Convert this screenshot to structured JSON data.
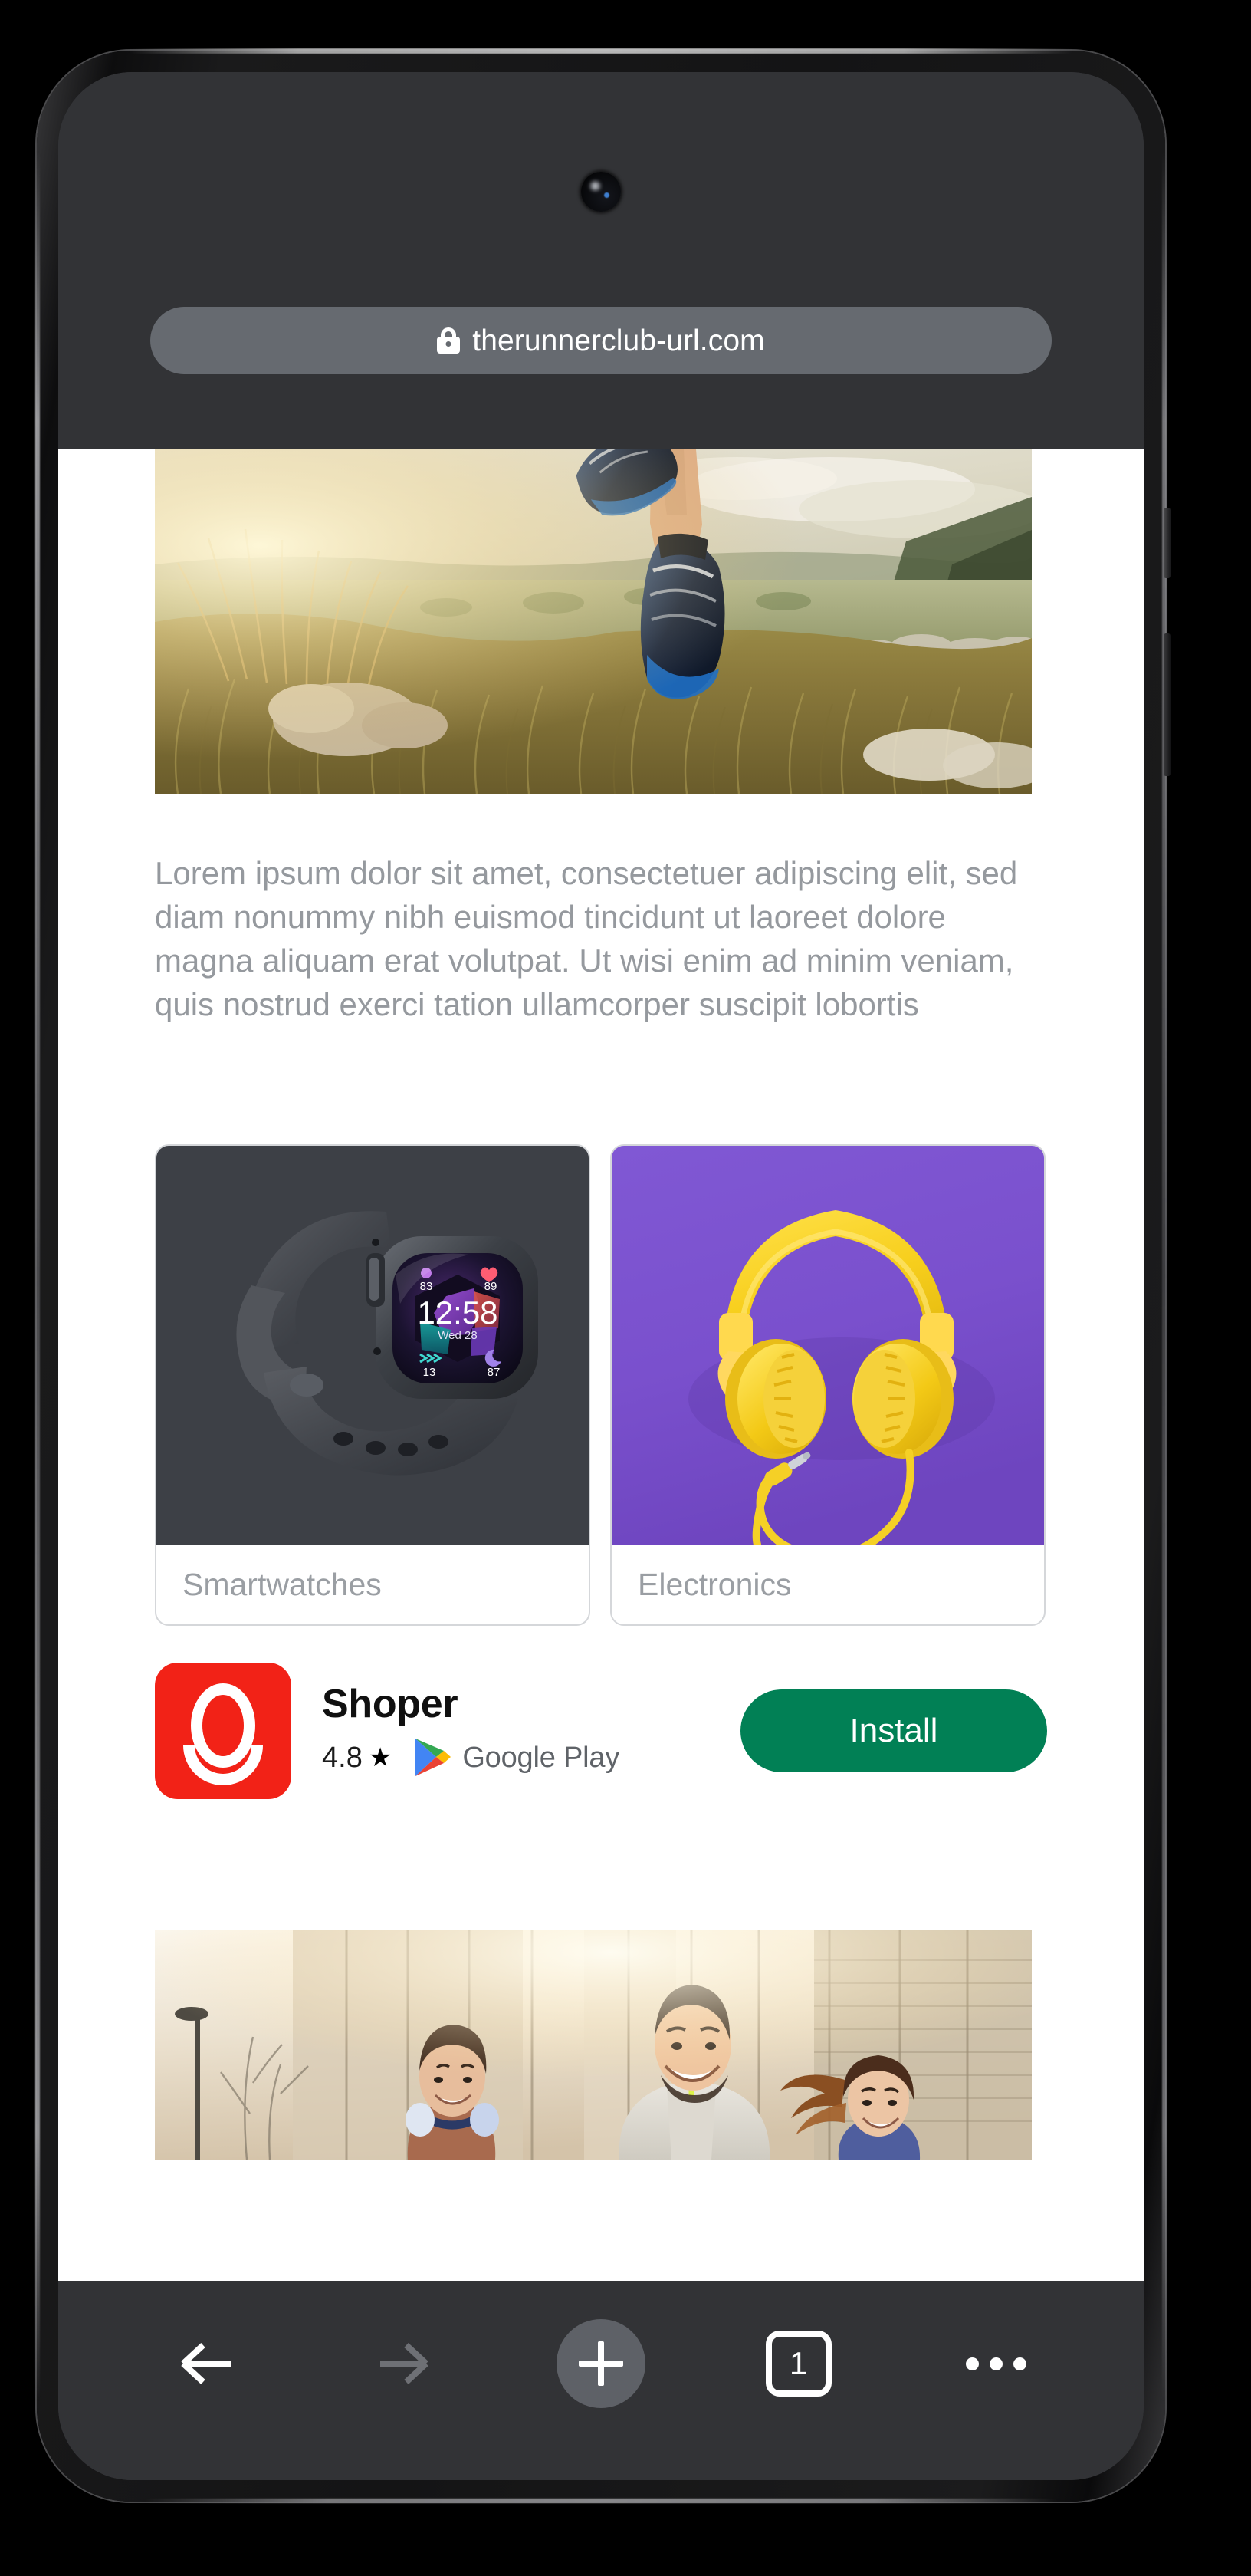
{
  "browser": {
    "url": "therunnerclub-url.com",
    "lock_icon": "lock-icon",
    "camera_icon": "front-camera"
  },
  "page": {
    "hero_image_alt": "trail-runner-on-hillside-at-sunset",
    "paragraph": "Lorem ipsum dolor sit amet, consectetuer adipiscing elit, sed diam nonummy nibh euismod tincidunt ut laoreet dolore magna aliquam erat volutpat. Ut wisi enim ad minim veniam, quis nostrud exerci tation ullamcorper suscipit lobortis",
    "cards": [
      {
        "label": "Smartwatches",
        "image_alt": "dark-grey-smartwatch-on-charcoal-background",
        "watch_face": {
          "time": "12:58",
          "date": "Wed 28",
          "metric_top_left": "83",
          "metric_top_right": "89",
          "metric_bottom_left": "13",
          "metric_bottom_right": "87"
        },
        "bg_color": "#3d4046"
      },
      {
        "label": "Electronics",
        "image_alt": "yellow-over-ear-headphones-on-purple-background",
        "bg_color": "#7d52cd"
      }
    ],
    "photo2_alt": "three-smiling-runners-jogging-in-city-at-sunrise"
  },
  "app_banner": {
    "app_name": "Shoper",
    "rating": "4.8",
    "star_glyph": "★",
    "store_name": "Google Play",
    "store_logo": "google-play-icon",
    "install_label": "Install",
    "install_color": "#018055",
    "icon_color": "#f22217"
  },
  "navbar": {
    "back_label": "Back",
    "forward_label": "Forward",
    "new_tab_label": "New tab",
    "tab_count": "1",
    "menu_label": "More options"
  }
}
